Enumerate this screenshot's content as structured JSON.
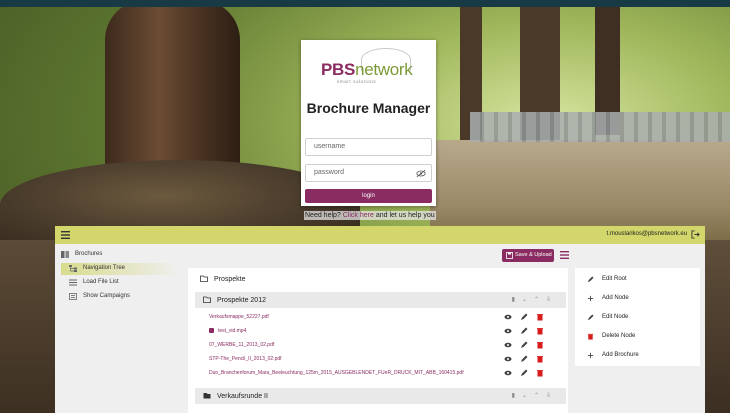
{
  "login": {
    "brand_a": "PBS",
    "brand_b": "network",
    "tagline": "smart solutions",
    "title": "Brochure Manager",
    "username_placeholder": "username",
    "password_placeholder": "password",
    "submit_label": "login",
    "help_prefix": "Need help?",
    "help_link": "Click here",
    "help_suffix": "and let us help you"
  },
  "app": {
    "user_email": "t.mouslarikos@pbsnetwork.eu",
    "save_label": "Save & Upload",
    "sidebar": {
      "brochures": "Brochures",
      "navigation_tree": "Navigation Tree",
      "load_file_list": "Load File List",
      "show_campaigns": "Show Campaigns"
    },
    "tree": {
      "root": "Prospekte",
      "node1": "Prospekte 2012",
      "files": [
        "Verkaufsmappe_52227.pdf",
        "test_vid.mp4",
        "07_WERBE_11_2013_02.pdf",
        "STP-The_Pencil_II_2013_02.pdf",
        "Duo_Branchenforum_Mara_Beeleuchtung_125m_2015_AUSGEBLENDET_FUeR_DRUCK_MIT_ABB_160415.pdf"
      ],
      "node2": "Verkaufsrunde II"
    },
    "actions": {
      "edit_root": "Edit Root",
      "add_node": "Add Node",
      "edit_node": "Edit Node",
      "delete_node": "Delete Node",
      "add_brochure": "Add Brochure"
    }
  },
  "colors": {
    "brand_primary": "#8a2c62",
    "brand_secondary": "#7a9a36",
    "app_bar": "#d3d66a",
    "delete": "#d81b1b"
  }
}
